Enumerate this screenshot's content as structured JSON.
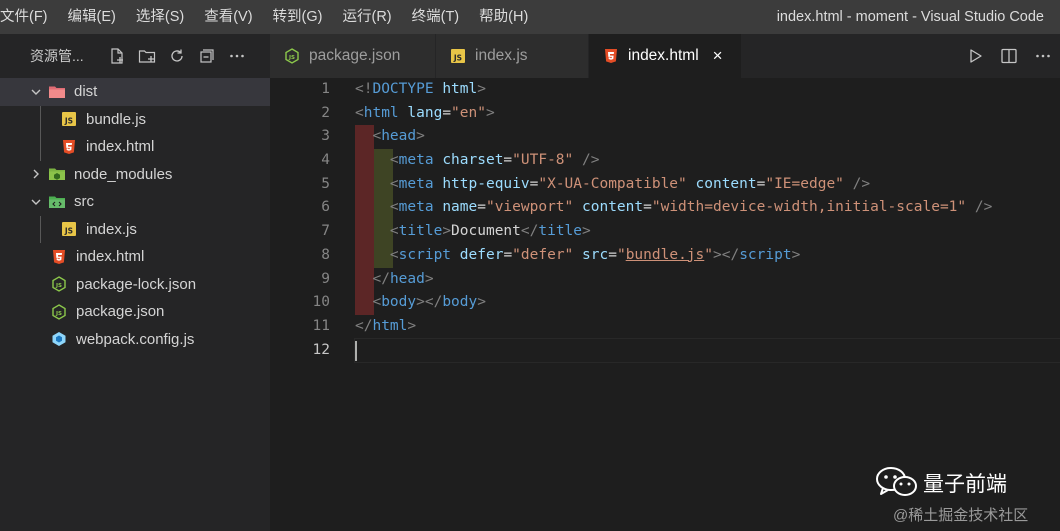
{
  "menu": [
    {
      "label": "文件(F)"
    },
    {
      "label": "编辑(E)"
    },
    {
      "label": "选择(S)"
    },
    {
      "label": "查看(V)"
    },
    {
      "label": "转到(G)"
    },
    {
      "label": "运行(R)"
    },
    {
      "label": "终端(T)"
    },
    {
      "label": "帮助(H)"
    }
  ],
  "window_title": "index.html - moment - Visual Studio Code",
  "explorer": {
    "title": "资源管...",
    "actions": [
      "new-file-icon",
      "new-folder-icon",
      "refresh-icon",
      "collapse-all-icon",
      "more-icon"
    ],
    "tree": [
      {
        "label": "dist",
        "type": "folder",
        "expanded": true,
        "icon": "folder-dist-icon",
        "selected": true
      },
      {
        "label": "bundle.js",
        "type": "js",
        "icon": "js-file-icon"
      },
      {
        "label": "index.html",
        "type": "html",
        "icon": "html-file-icon"
      },
      {
        "label": "node_modules",
        "type": "folder",
        "expanded": false,
        "icon": "folder-node-modules-icon"
      },
      {
        "label": "src",
        "type": "folder",
        "expanded": true,
        "icon": "folder-src-icon"
      },
      {
        "label": "index.js",
        "type": "js",
        "icon": "js-file-icon"
      },
      {
        "label": "index.html",
        "type": "html",
        "icon": "html-file-icon"
      },
      {
        "label": "package-lock.json",
        "type": "node",
        "icon": "node-js-icon"
      },
      {
        "label": "package.json",
        "type": "node",
        "icon": "node-js-icon"
      },
      {
        "label": "webpack.config.js",
        "type": "webpack",
        "icon": "webpack-icon"
      }
    ]
  },
  "tabs": [
    {
      "label": "package.json",
      "icon": "node-js-icon",
      "active": false
    },
    {
      "label": "index.js",
      "icon": "js-file-icon",
      "active": false
    },
    {
      "label": "index.html",
      "icon": "html5-icon",
      "active": true,
      "close": "×"
    }
  ],
  "editor": {
    "line_numbers": [
      "1",
      "2",
      "3",
      "4",
      "5",
      "6",
      "7",
      "8",
      "9",
      "10",
      "11",
      "12"
    ],
    "current_line": 12,
    "lines": [
      [
        {
          "t": "<!",
          "c": "br"
        },
        {
          "t": "DOCTYPE",
          "c": "tag"
        },
        {
          "t": " ",
          "c": "txt"
        },
        {
          "t": "html",
          "c": "attr"
        },
        {
          "t": ">",
          "c": "br"
        }
      ],
      [
        {
          "t": "<",
          "c": "br"
        },
        {
          "t": "html",
          "c": "tag"
        },
        {
          "t": " ",
          "c": "txt"
        },
        {
          "t": "lang",
          "c": "attr"
        },
        {
          "t": "=",
          "c": "txt"
        },
        {
          "t": "\"en\"",
          "c": "str"
        },
        {
          "t": ">",
          "c": "br"
        }
      ],
      [
        {
          "t": "  ",
          "c": "txt"
        },
        {
          "t": "<",
          "c": "br"
        },
        {
          "t": "head",
          "c": "tag"
        },
        {
          "t": ">",
          "c": "br"
        }
      ],
      [
        {
          "t": "    ",
          "c": "txt"
        },
        {
          "t": "<",
          "c": "br"
        },
        {
          "t": "meta",
          "c": "tag"
        },
        {
          "t": " ",
          "c": "txt"
        },
        {
          "t": "charset",
          "c": "attr"
        },
        {
          "t": "=",
          "c": "txt"
        },
        {
          "t": "\"UTF-8\"",
          "c": "str"
        },
        {
          "t": " ",
          "c": "txt"
        },
        {
          "t": "/>",
          "c": "br"
        }
      ],
      [
        {
          "t": "    ",
          "c": "txt"
        },
        {
          "t": "<",
          "c": "br"
        },
        {
          "t": "meta",
          "c": "tag"
        },
        {
          "t": " ",
          "c": "txt"
        },
        {
          "t": "http-equiv",
          "c": "attr"
        },
        {
          "t": "=",
          "c": "txt"
        },
        {
          "t": "\"X-UA-Compatible\"",
          "c": "str"
        },
        {
          "t": " ",
          "c": "txt"
        },
        {
          "t": "content",
          "c": "attr"
        },
        {
          "t": "=",
          "c": "txt"
        },
        {
          "t": "\"IE=edge\"",
          "c": "str"
        },
        {
          "t": " ",
          "c": "txt"
        },
        {
          "t": "/>",
          "c": "br"
        }
      ],
      [
        {
          "t": "    ",
          "c": "txt"
        },
        {
          "t": "<",
          "c": "br"
        },
        {
          "t": "meta",
          "c": "tag"
        },
        {
          "t": " ",
          "c": "txt"
        },
        {
          "t": "name",
          "c": "attr"
        },
        {
          "t": "=",
          "c": "txt"
        },
        {
          "t": "\"viewport\"",
          "c": "str"
        },
        {
          "t": " ",
          "c": "txt"
        },
        {
          "t": "content",
          "c": "attr"
        },
        {
          "t": "=",
          "c": "txt"
        },
        {
          "t": "\"width=device-width,initial-scale=1\"",
          "c": "str"
        },
        {
          "t": " ",
          "c": "txt"
        },
        {
          "t": "/>",
          "c": "br"
        }
      ],
      [
        {
          "t": "    ",
          "c": "txt"
        },
        {
          "t": "<",
          "c": "br"
        },
        {
          "t": "title",
          "c": "tag"
        },
        {
          "t": ">",
          "c": "br"
        },
        {
          "t": "Document",
          "c": "txt"
        },
        {
          "t": "</",
          "c": "br"
        },
        {
          "t": "title",
          "c": "tag"
        },
        {
          "t": ">",
          "c": "br"
        }
      ],
      [
        {
          "t": "    ",
          "c": "txt"
        },
        {
          "t": "<",
          "c": "br"
        },
        {
          "t": "script",
          "c": "tag"
        },
        {
          "t": " ",
          "c": "txt"
        },
        {
          "t": "defer",
          "c": "attr"
        },
        {
          "t": "=",
          "c": "txt"
        },
        {
          "t": "\"defer\"",
          "c": "str"
        },
        {
          "t": " ",
          "c": "txt"
        },
        {
          "t": "src",
          "c": "attr"
        },
        {
          "t": "=",
          "c": "txt"
        },
        {
          "t": "\"",
          "c": "str"
        },
        {
          "t": "bundle.js",
          "c": "str link"
        },
        {
          "t": "\"",
          "c": "str"
        },
        {
          "t": ">",
          "c": "br"
        },
        {
          "t": "</",
          "c": "br"
        },
        {
          "t": "script",
          "c": "tag"
        },
        {
          "t": ">",
          "c": "br"
        }
      ],
      [
        {
          "t": "  ",
          "c": "txt"
        },
        {
          "t": "</",
          "c": "br"
        },
        {
          "t": "head",
          "c": "tag"
        },
        {
          "t": ">",
          "c": "br"
        }
      ],
      [
        {
          "t": "  ",
          "c": "txt"
        },
        {
          "t": "<",
          "c": "br"
        },
        {
          "t": "body",
          "c": "tag"
        },
        {
          "t": ">",
          "c": "br"
        },
        {
          "t": "</",
          "c": "br"
        },
        {
          "t": "body",
          "c": "tag"
        },
        {
          "t": ">",
          "c": "br"
        }
      ],
      [
        {
          "t": "</",
          "c": "br"
        },
        {
          "t": "html",
          "c": "tag"
        },
        {
          "t": ">",
          "c": "br"
        }
      ],
      []
    ],
    "indent_guides": [
      0,
      0,
      1,
      2,
      2,
      2,
      2,
      2,
      1,
      1,
      0,
      0
    ]
  },
  "tab_actions": [
    "run-icon",
    "split-editor-icon",
    "more-actions-icon"
  ],
  "watermark": {
    "name": "量子前端",
    "sub": "@稀土掘金技术社区"
  },
  "colors": {
    "tag": "#569cd6",
    "attr": "#9cdcfe",
    "str": "#ce9178",
    "bracket": "#808080",
    "js": "#e8c547",
    "html": "#e44d26",
    "node": "#8cc84b",
    "webpack": "#8ed6fb"
  }
}
